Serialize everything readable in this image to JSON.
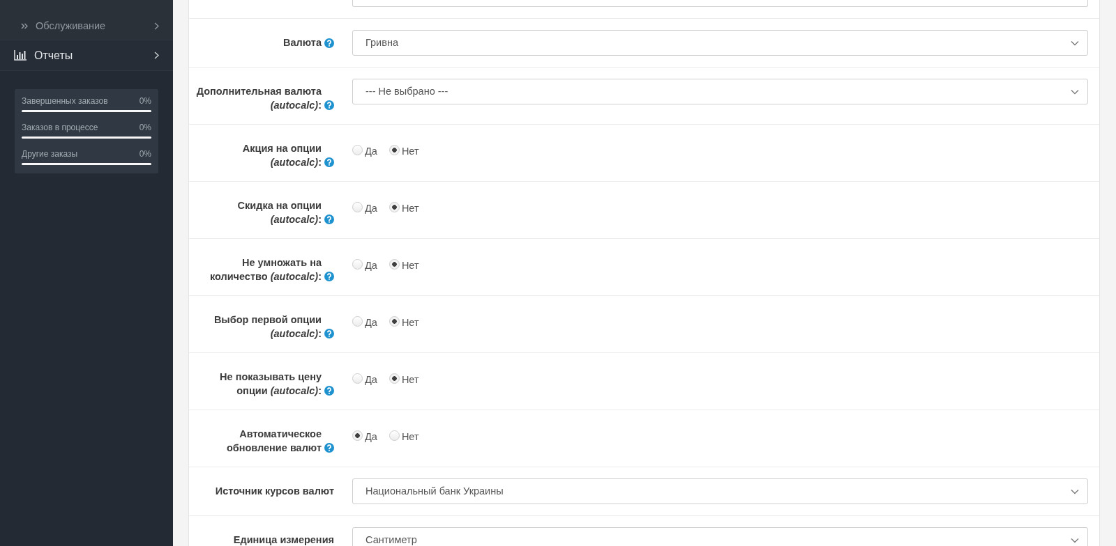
{
  "sidebar": {
    "menu": [
      {
        "kind": "subitem",
        "label": "Обслуживание"
      },
      {
        "kind": "item",
        "label": "Отчеты"
      }
    ],
    "stats": [
      {
        "label": "Завершенных заказов",
        "reading": "0%",
        "level": 0
      },
      {
        "label": "Заказов в процессе",
        "reading": "0%",
        "level": 0
      },
      {
        "label": "Другие заказы",
        "reading": "0%",
        "level": 0
      }
    ]
  },
  "form": {
    "rows": [
      {
        "kind": "text"
      },
      {
        "kind": "select",
        "label": "Валюта",
        "help": true,
        "value": "Гривна"
      },
      {
        "kind": "select",
        "label": "Дополнительная валюта *(autocalc)*:",
        "help": true,
        "value": "--- Не выбрано ---"
      },
      {
        "kind": "radio",
        "label": "Акция на опции *(autocalc)*:",
        "help": true,
        "options": [
          {
            "label": "Да",
            "selected": false
          },
          {
            "label": "Нет",
            "selected": true
          }
        ]
      },
      {
        "kind": "radio",
        "label": "Скидка на опции *(autocalc)*:",
        "help": true,
        "options": [
          {
            "label": "Да",
            "selected": false
          },
          {
            "label": "Нет",
            "selected": true
          }
        ]
      },
      {
        "kind": "radio",
        "label": "Не умножать на количество *(autocalc)*:",
        "help": true,
        "options": [
          {
            "label": "Да",
            "selected": false
          },
          {
            "label": "Нет",
            "selected": true
          }
        ]
      },
      {
        "kind": "radio",
        "label": "Выбор первой опции *(autocalc)*:",
        "help": true,
        "options": [
          {
            "label": "Да",
            "selected": false
          },
          {
            "label": "Нет",
            "selected": true
          }
        ]
      },
      {
        "kind": "radio",
        "label": "Не показывать цену опции *(autocalc)*:",
        "help": true,
        "options": [
          {
            "label": "Да",
            "selected": false
          },
          {
            "label": "Нет",
            "selected": true
          }
        ]
      },
      {
        "kind": "radio",
        "label": "Автоматическое обновление валют",
        "help": true,
        "options": [
          {
            "label": "Да",
            "selected": true
          },
          {
            "label": "Нет",
            "selected": false
          }
        ]
      },
      {
        "kind": "select",
        "label": "Источник курсов валют",
        "help": false,
        "value": "Национальный банк Украины"
      },
      {
        "kind": "select",
        "label": "Единица измерения",
        "help": false,
        "value": "Сантиметр"
      }
    ]
  }
}
